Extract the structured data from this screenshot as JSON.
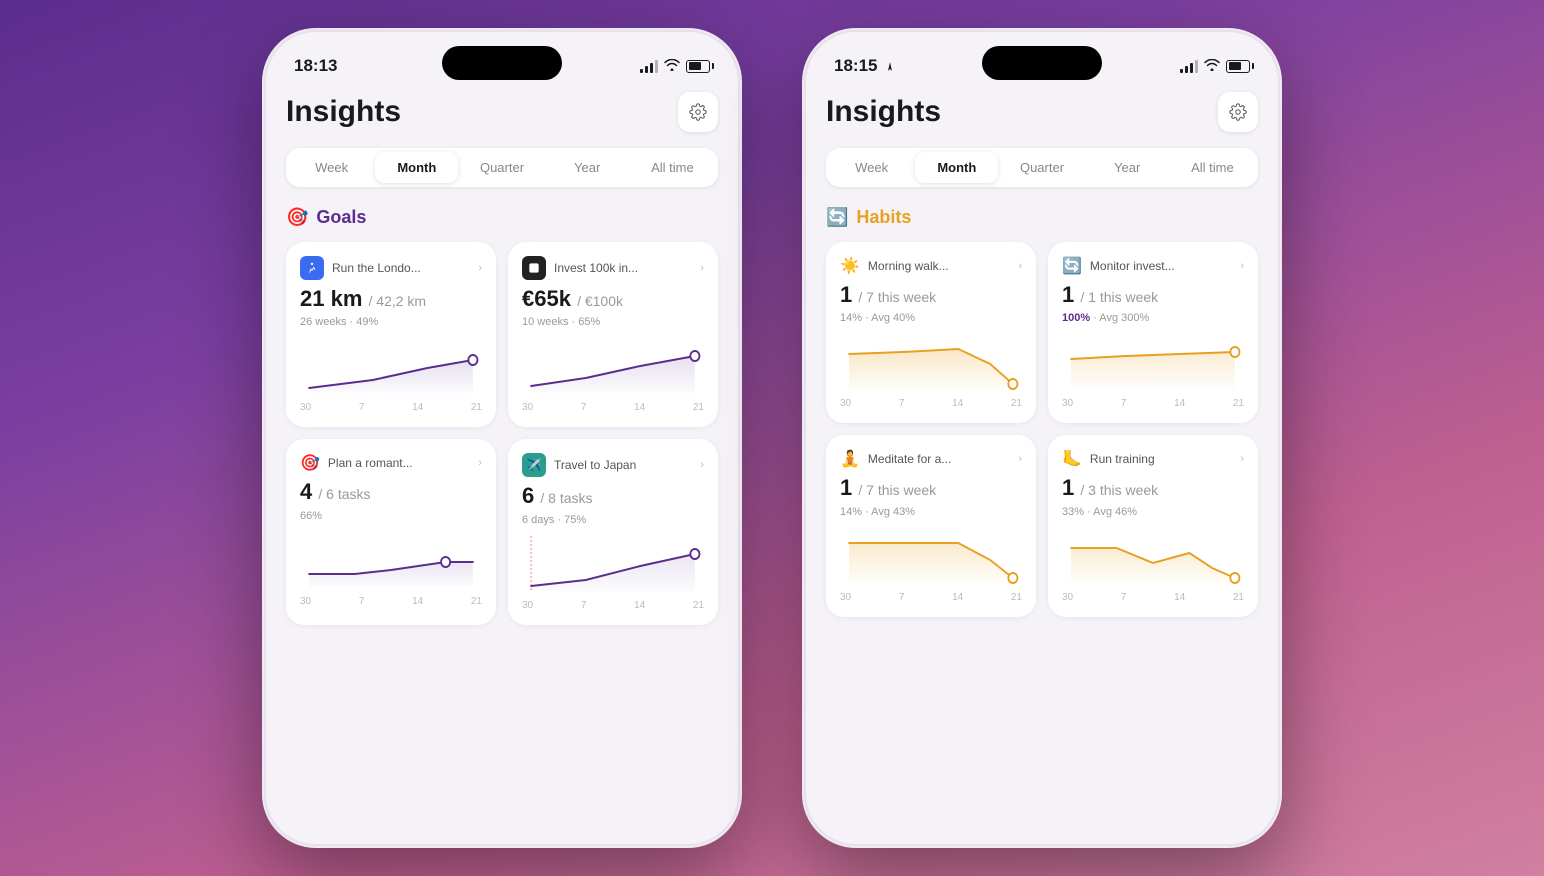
{
  "phone1": {
    "statusBar": {
      "time": "18:13",
      "hasLocation": false
    },
    "header": {
      "title": "Insights",
      "settingsLabel": "settings"
    },
    "tabs": {
      "items": [
        "Week",
        "Month",
        "Quarter",
        "Year",
        "All time"
      ],
      "active": "Month"
    },
    "section": {
      "icon": "🎯",
      "title": "Goals",
      "type": "goals"
    },
    "cards": [
      {
        "id": "run-london",
        "icon": "🏃",
        "iconClass": "blue",
        "name": "Run the Londo...",
        "value": "21 km",
        "total": "/ 42,2 km",
        "meta1": "26 weeks · 49%",
        "chartColor": "#5b2d8e",
        "chartType": "line-up",
        "labels": [
          "30",
          "7",
          "14",
          "21"
        ]
      },
      {
        "id": "invest",
        "icon": "⬛",
        "iconClass": "dark",
        "name": "Invest 100k in...",
        "value": "€65k",
        "total": "/ €100k",
        "meta1": "10 weeks · 65%",
        "chartColor": "#5b2d8e",
        "chartType": "line-up",
        "labels": [
          "30",
          "7",
          "14",
          "21"
        ]
      },
      {
        "id": "plan-romantic",
        "icon": "🎯",
        "iconClass": "gray",
        "name": "Plan a romant...",
        "value": "4",
        "total": "/ 6 tasks",
        "meta1": "66%",
        "chartColor": "#5b2d8e",
        "chartType": "line-flat",
        "labels": [
          "30",
          "7",
          "14",
          "21"
        ]
      },
      {
        "id": "travel-japan",
        "icon": "✈️",
        "iconClass": "teal",
        "name": "Travel to Japan",
        "value": "6",
        "total": "/ 8 tasks",
        "meta1": "6 days · 75%",
        "chartColor": "#5b2d8e",
        "chartType": "line-up-red",
        "labels": [
          "30",
          "7",
          "14",
          "21"
        ]
      }
    ]
  },
  "phone2": {
    "statusBar": {
      "time": "18:15",
      "hasLocation": true
    },
    "header": {
      "title": "Insights",
      "settingsLabel": "settings"
    },
    "tabs": {
      "items": [
        "Week",
        "Month",
        "Quarter",
        "Year",
        "All time"
      ],
      "active": "Month"
    },
    "section": {
      "icon": "🔄",
      "title": "Habits",
      "type": "habits"
    },
    "cards": [
      {
        "id": "morning-walk",
        "icon": "☀️",
        "iconClass": "none",
        "name": "Morning walk...",
        "value": "1",
        "week": "/ 7 this week",
        "meta1": "14%",
        "meta2": "Avg 40%",
        "chartColor": "#e8a020",
        "chartType": "habit-down",
        "labels": [
          "30",
          "7",
          "14",
          "21"
        ]
      },
      {
        "id": "monitor-invest",
        "icon": "🔄",
        "iconClass": "none",
        "name": "Monitor invest...",
        "value": "1",
        "week": "/ 1 this week",
        "meta1": "100%",
        "meta1Color": "purple",
        "meta2": "Avg 300%",
        "chartColor": "#e8a020",
        "chartType": "habit-flat",
        "labels": [
          "30",
          "7",
          "14",
          "21"
        ]
      },
      {
        "id": "meditate",
        "icon": "🧘",
        "iconClass": "none",
        "name": "Meditate for a...",
        "value": "1",
        "week": "/ 7 this week",
        "meta1": "14%",
        "meta2": "Avg 43%",
        "chartColor": "#e8a020",
        "chartType": "habit-down2",
        "labels": [
          "30",
          "7",
          "14",
          "21"
        ]
      },
      {
        "id": "run-training",
        "icon": "🦶",
        "iconClass": "none",
        "name": "Run training",
        "value": "1",
        "week": "/ 3 this week",
        "meta1": "33%",
        "meta2": "Avg 46%",
        "chartColor": "#e8a020",
        "chartType": "habit-wave",
        "labels": [
          "30",
          "7",
          "14",
          "21"
        ]
      }
    ]
  }
}
